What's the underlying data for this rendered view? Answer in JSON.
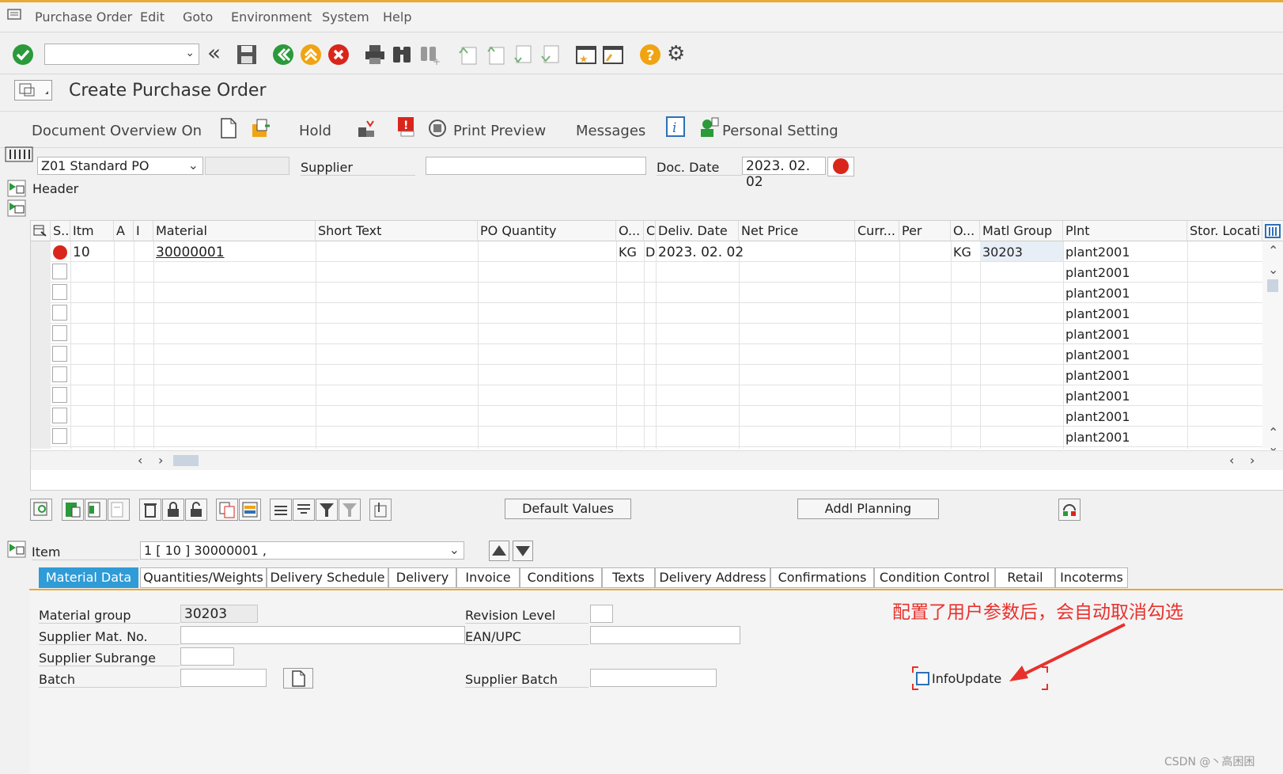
{
  "menu": [
    "Purchase Order",
    "Edit",
    "Goto",
    "Environment",
    "System",
    "Help"
  ],
  "title": "Create Purchase Order",
  "app_toolbar": {
    "doc_overview": "Document Overview On",
    "hold": "Hold",
    "print_preview": "Print Preview",
    "messages": "Messages",
    "personal_setting": "Personal Setting"
  },
  "header": {
    "po_type": "Z01 Standard PO",
    "supplier_label": "Supplier",
    "supplier_value": "",
    "doc_date_label": "Doc. Date",
    "doc_date_value": "2023. 02. 02",
    "header_label": "Header"
  },
  "grid": {
    "columns": [
      "S..",
      "Itm",
      "A",
      "I",
      "Material",
      "Short Text",
      "PO Quantity",
      "O...",
      "C",
      "Deliv. Date",
      "Net Price",
      "Curr...",
      "Per",
      "O...",
      "Matl Group",
      "Plnt",
      "Stor. Locati"
    ],
    "row1": {
      "itm": "10",
      "material": "30000001",
      "unit": "KG",
      "cat": "D",
      "deliv_date": "2023. 02. 02",
      "order_unit": "KG",
      "matl_group": "30203",
      "plant": "plant2001"
    },
    "plants": [
      "plant2001",
      "plant2001",
      "plant2001",
      "plant2001",
      "plant2001",
      "plant2001",
      "plant2001",
      "plant2001",
      "plant2001",
      "plant2001",
      "plant2001"
    ]
  },
  "buttons": {
    "default_values": "Default Values",
    "addl_planning": "Addl Planning"
  },
  "item": {
    "label": "Item",
    "selector": "1 [ 10 ] 30000001 ,"
  },
  "tabs": [
    "Material Data",
    "Quantities/Weights",
    "Delivery Schedule",
    "Delivery",
    "Invoice",
    "Conditions",
    "Texts",
    "Delivery Address",
    "Confirmations",
    "Condition Control",
    "Retail",
    "Incoterms"
  ],
  "material_data": {
    "material_group_label": "Material group",
    "material_group_value": "30203",
    "supplier_mat_no_label": "Supplier Mat. No.",
    "supplier_subrange_label": "Supplier Subrange",
    "batch_label": "Batch",
    "revision_level_label": "Revision Level",
    "ean_upc_label": "EAN/UPC",
    "supplier_batch_label": "Supplier Batch",
    "info_update_label": "InfoUpdate"
  },
  "annotation": "配置了用户参数后，会自动取消勾选",
  "watermark": "CSDN @丶高困困",
  "colors": {
    "accent": "#2f9bd7",
    "annotation": "#e8312c",
    "status_red": "#d9261c",
    "topline": "#e8a935"
  }
}
